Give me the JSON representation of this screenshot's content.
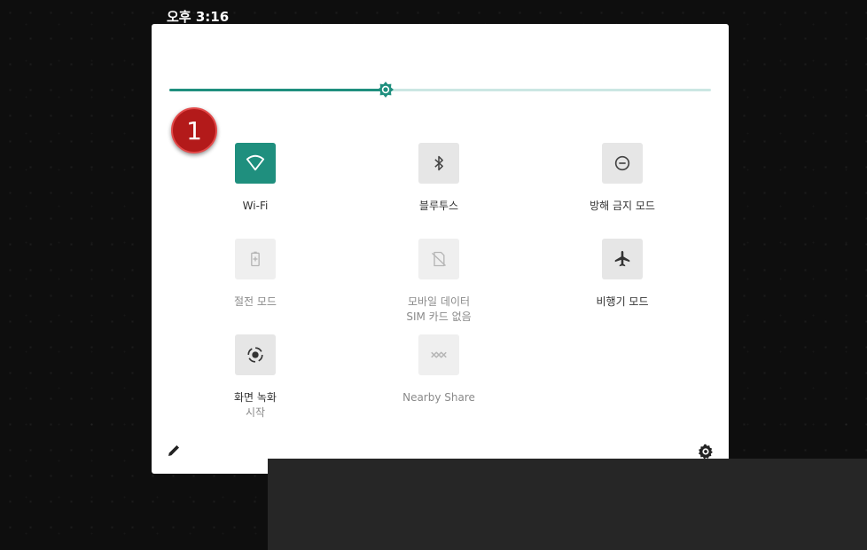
{
  "status_bar": {
    "time": "오후 3:16"
  },
  "brightness": {
    "level": 0.4
  },
  "annotation": {
    "badge_number": "1"
  },
  "tiles": [
    {
      "name": "wifi",
      "label": "Wi-Fi",
      "state": "on",
      "icon": "wifi-icon"
    },
    {
      "name": "bluetooth",
      "label": "블루투스",
      "state": "off",
      "icon": "bluetooth-icon"
    },
    {
      "name": "dnd",
      "label": "방해 금지 모드",
      "state": "off",
      "icon": "do-not-disturb-icon"
    },
    {
      "name": "battery-saver",
      "label": "절전 모드",
      "state": "disabled",
      "icon": "battery-saver-icon"
    },
    {
      "name": "mobile-data",
      "label": "모바일 데이터",
      "sublabel": "SIM 카드 없음",
      "state": "disabled",
      "icon": "no-sim-icon"
    },
    {
      "name": "airplane",
      "label": "비행기 모드",
      "state": "off",
      "icon": "airplane-icon"
    },
    {
      "name": "screen-record",
      "label": "화면 녹화",
      "sublabel": "시작",
      "state": "off",
      "icon": "screen-record-icon"
    },
    {
      "name": "nearby-share",
      "label": "Nearby Share",
      "state": "disabled",
      "icon": "nearby-share-icon"
    }
  ],
  "footer": {
    "edit_icon": "pencil-icon",
    "settings_icon": "gear-icon"
  },
  "colors": {
    "accent": "#1f8f7e",
    "track": "#cbe7e3",
    "badge": "#b31a1a"
  }
}
